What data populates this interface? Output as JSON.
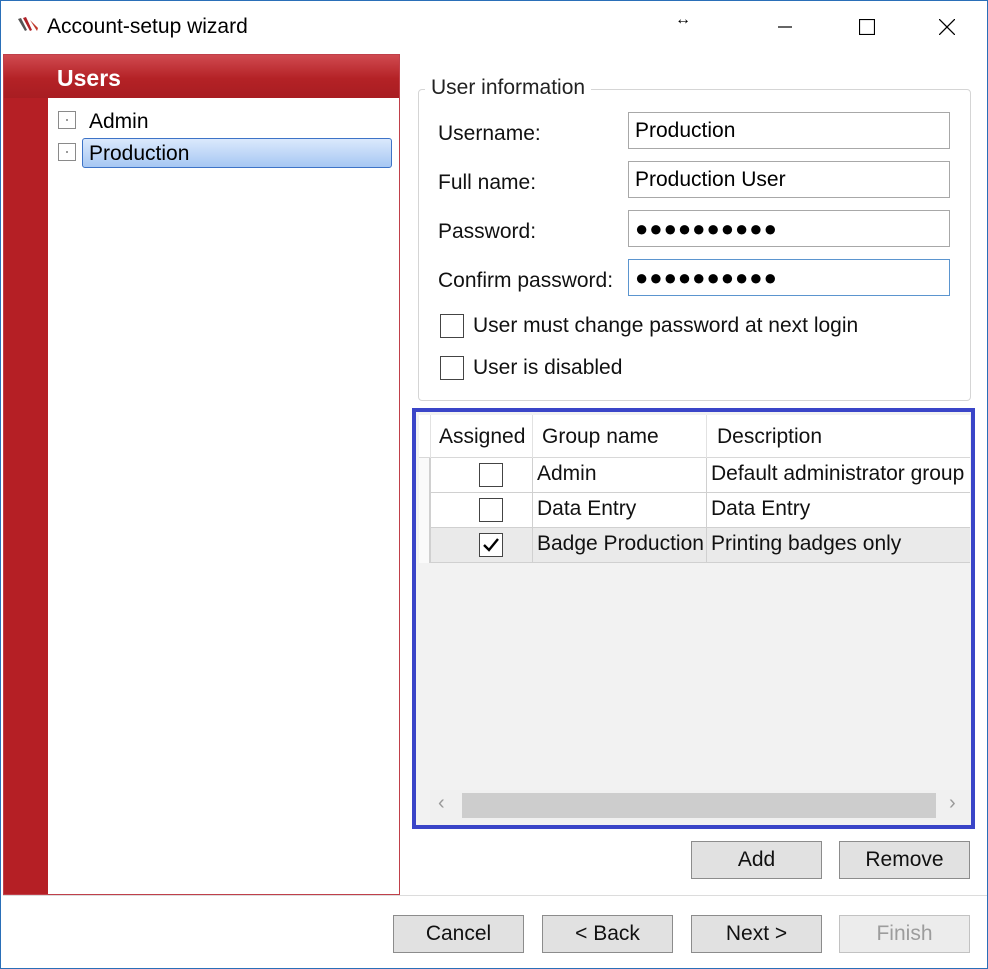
{
  "window": {
    "title": "Account-setup wizard",
    "resize_glyph": "↔"
  },
  "users_panel": {
    "title": "Users",
    "items": [
      {
        "label": "Admin",
        "selected": false
      },
      {
        "label": "Production",
        "selected": true
      }
    ]
  },
  "user_info": {
    "legend": "User information",
    "username_label": "Username:",
    "username_value": "Production",
    "fullname_label": "Full name:",
    "fullname_value": "Production User",
    "password_label": "Password:",
    "password_value": "●●●●●●●●●●",
    "confirm_label": "Confirm password:",
    "confirm_value": "●●●●●●●●●●",
    "must_change_label": "User must change password at next login",
    "must_change_checked": false,
    "disabled_label": "User is disabled",
    "disabled_checked": false
  },
  "groups": {
    "columns": [
      "Assigned",
      "Group name",
      "Description"
    ],
    "rows": [
      {
        "assigned": false,
        "name": "Admin",
        "description": "Default administrator group"
      },
      {
        "assigned": false,
        "name": "Data Entry",
        "description": "Data Entry"
      },
      {
        "assigned": true,
        "name": "Badge Production",
        "description": "Printing badges only"
      }
    ]
  },
  "group_actions": {
    "add": "Add",
    "remove": "Remove"
  },
  "wizard_buttons": {
    "cancel": "Cancel",
    "back": "< Back",
    "next": "Next >",
    "finish": "Finish"
  },
  "colors": {
    "users_header": "#b42226",
    "selection": "#a6c7f3",
    "grid_focus_border": "#3a45c8"
  },
  "icons": {
    "app": "app-logo-icon",
    "minimize": "minimize-icon",
    "maximize": "maximize-icon",
    "close": "close-icon",
    "checkmark": "checkmark-icon",
    "scroll_left": "chevron-left-icon",
    "scroll_right": "chevron-right-icon"
  }
}
